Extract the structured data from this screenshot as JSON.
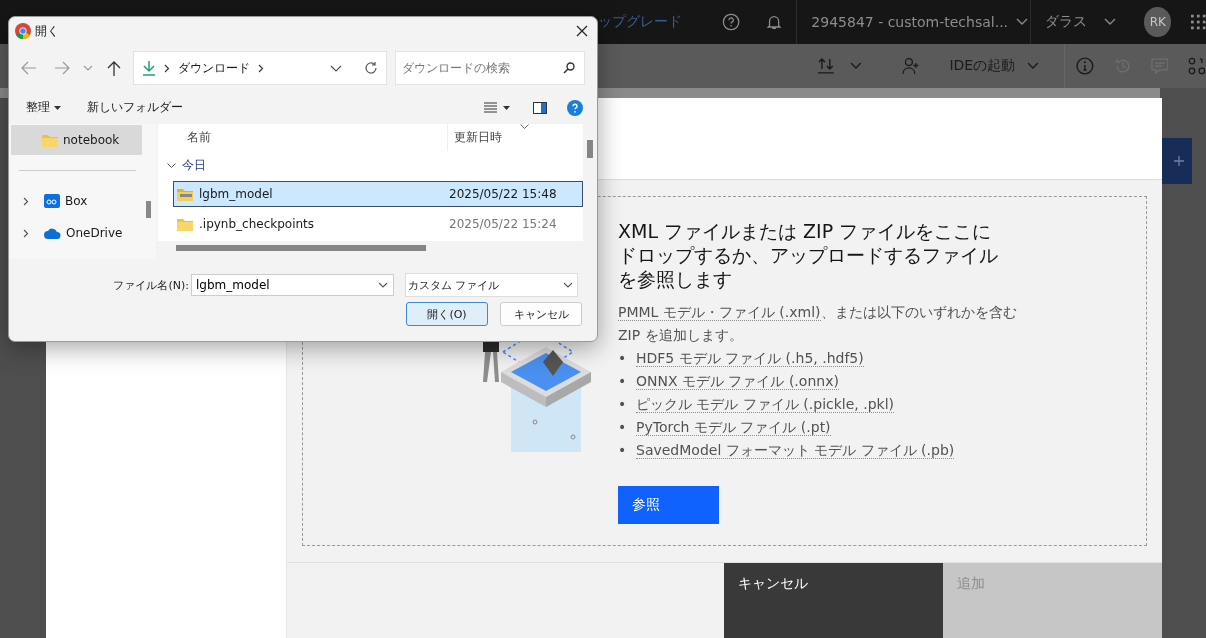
{
  "app_header": {
    "upgrade_link": "ップグレード",
    "account": "2945847 - custom-techsal...",
    "region": "ダラス",
    "avatar": "RK"
  },
  "toolbar": {
    "ide_button": "IDEの起動"
  },
  "modal": {
    "drop_zone": {
      "heading": "XML ファイルまたは ZIP ファイルをここにドロップするか、アップロードするファイルを参照します",
      "description_link": "PMML モデル・ファイル (.xml)",
      "description_text": "、または以下のいずれかを含む ZIP を追加します。",
      "formats": [
        {
          "bullet": "•",
          "label": "HDF5 モデル ファイル (.h5, .hdf5)"
        },
        {
          "bullet": "•",
          "label": "ONNX モデル ファイル (.onnx)"
        },
        {
          "bullet": "•",
          "label": "ピックル モデル ファイル (.pickle, .pkl)"
        },
        {
          "bullet": "•",
          "label": "PyTorch モデル ファイル (.pt)"
        },
        {
          "bullet": "•",
          "label": "SavedModel フォーマット モデル ファイル (.pb)"
        }
      ],
      "browse_button": "参照"
    },
    "footer_buttons": [
      {
        "label": "キャンセル",
        "disabled": false
      },
      {
        "label": "追加",
        "disabled": true
      }
    ]
  },
  "file_dialog": {
    "title": "開く",
    "path": [
      "ダウンロード"
    ],
    "search": {
      "placeholder": "ダウンロードの検索"
    },
    "commands": [
      "整理",
      "新しいフォルダー"
    ],
    "nav_items": [
      {
        "label": "notebook",
        "kind": "folder",
        "selected": true
      },
      {
        "label": "Box",
        "kind": "box",
        "selected": false
      },
      {
        "label": "OneDrive",
        "kind": "onedrive",
        "selected": false
      }
    ],
    "columns": [
      "名前",
      "更新日時"
    ],
    "groups": [
      {
        "label": "今日",
        "expanded": true,
        "files": [
          {
            "name": "lgbm_model",
            "modified": "2025/05/22 15:48",
            "kind": "zip",
            "selected": true
          },
          {
            "name": ".ipynb_checkpoints",
            "modified": "2025/05/22 15:24",
            "kind": "folder",
            "selected": false
          }
        ]
      }
    ],
    "filename_label": "ファイル名(N):",
    "filename": "lgbm_model",
    "filter": "カスタム ファイル",
    "buttons": [
      {
        "label": "開く(O)",
        "kind": "primary"
      },
      {
        "label": "キャンセル",
        "kind": "secondary"
      }
    ]
  }
}
